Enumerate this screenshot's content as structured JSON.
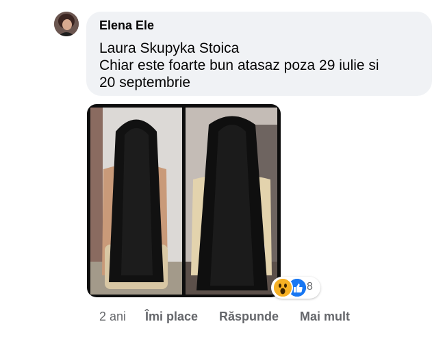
{
  "comment": {
    "author": "Elena Ele",
    "text_lines": [
      "Laura Skupyka Stoica",
      "Chiar este foarte bun atasaz poza 29 iulie si",
      "20 septembrie"
    ]
  },
  "reactions": {
    "icons": [
      "wow-reaction-icon",
      "like-reaction-icon"
    ],
    "count": "8"
  },
  "footer": {
    "time": "2 ani",
    "like": "Îmi place",
    "reply": "Răspunde",
    "more": "Mai mult"
  },
  "colors": {
    "bubble": "#f0f2f5",
    "secondary_text": "#65676b",
    "like_blue": "#1877f2",
    "wow_yellow": "#f7b125"
  }
}
